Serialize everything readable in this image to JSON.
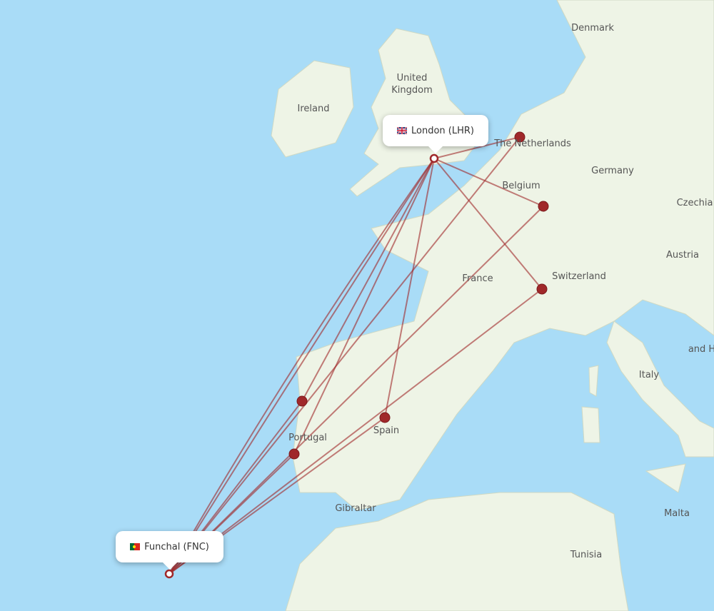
{
  "origin": {
    "label": "London (LHR)",
    "flag": "gb-flag-icon"
  },
  "destination": {
    "label": "Funchal (FNC)",
    "flag": "pt-flag-icon"
  },
  "route_color": "#a0282a",
  "land_color": "#eef4e6",
  "water_color": "#a9dcf7",
  "countries": [
    "Denmark",
    "United Kingdom",
    "Ireland",
    "The Netherlands",
    "Germany",
    "Belgium",
    "Czechia",
    "Austria",
    "Switzerland",
    "France",
    "Italy",
    "Portugal",
    "Spain",
    "Gibraltar",
    "Malta",
    "Tunisia",
    "and H"
  ]
}
